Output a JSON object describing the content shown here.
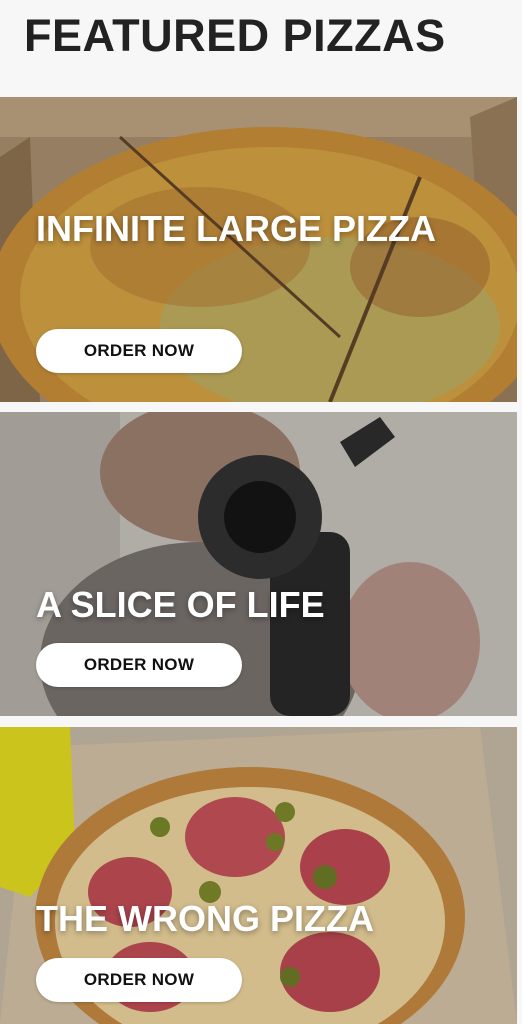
{
  "header": {
    "title": "FEATURED PIZZAS"
  },
  "cards": [
    {
      "title": "INFINITE LARGE PIZZA",
      "button_label": "ORDER NOW",
      "image": "pizza-in-box-photo"
    },
    {
      "title": "A SLICE OF LIFE",
      "button_label": "ORDER NOW",
      "image": "blurry-person-photo"
    },
    {
      "title": "THE WRONG PIZZA",
      "button_label": "ORDER NOW",
      "image": "pepperoni-pizza-photo"
    }
  ],
  "colors": {
    "background": "#f7f7f7",
    "title": "#222222",
    "button_bg": "#ffffff",
    "button_text": "#111111"
  }
}
